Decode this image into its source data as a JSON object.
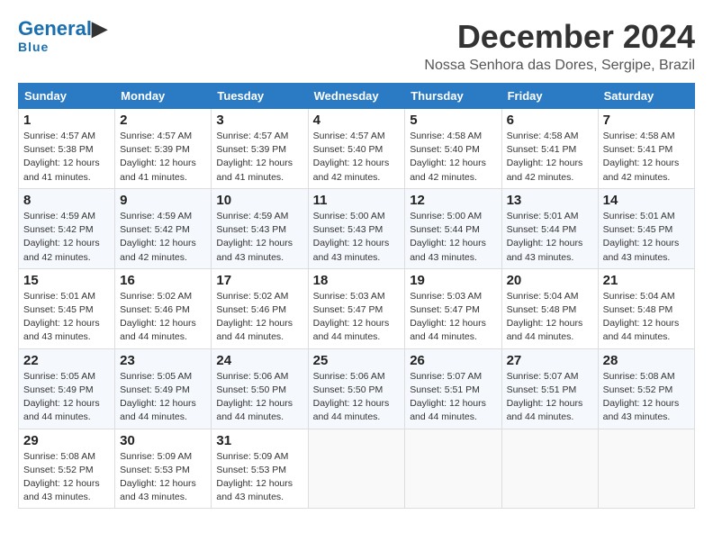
{
  "header": {
    "logo_line1": "General",
    "logo_line2": "Blue",
    "main_title": "December 2024",
    "sub_title": "Nossa Senhora das Dores, Sergipe, Brazil"
  },
  "calendar": {
    "days_of_week": [
      "Sunday",
      "Monday",
      "Tuesday",
      "Wednesday",
      "Thursday",
      "Friday",
      "Saturday"
    ],
    "weeks": [
      [
        {
          "day": "1",
          "info": "Sunrise: 4:57 AM\nSunset: 5:38 PM\nDaylight: 12 hours and 41 minutes."
        },
        {
          "day": "2",
          "info": "Sunrise: 4:57 AM\nSunset: 5:39 PM\nDaylight: 12 hours and 41 minutes."
        },
        {
          "day": "3",
          "info": "Sunrise: 4:57 AM\nSunset: 5:39 PM\nDaylight: 12 hours and 41 minutes."
        },
        {
          "day": "4",
          "info": "Sunrise: 4:57 AM\nSunset: 5:40 PM\nDaylight: 12 hours and 42 minutes."
        },
        {
          "day": "5",
          "info": "Sunrise: 4:58 AM\nSunset: 5:40 PM\nDaylight: 12 hours and 42 minutes."
        },
        {
          "day": "6",
          "info": "Sunrise: 4:58 AM\nSunset: 5:41 PM\nDaylight: 12 hours and 42 minutes."
        },
        {
          "day": "7",
          "info": "Sunrise: 4:58 AM\nSunset: 5:41 PM\nDaylight: 12 hours and 42 minutes."
        }
      ],
      [
        {
          "day": "8",
          "info": "Sunrise: 4:59 AM\nSunset: 5:42 PM\nDaylight: 12 hours and 42 minutes."
        },
        {
          "day": "9",
          "info": "Sunrise: 4:59 AM\nSunset: 5:42 PM\nDaylight: 12 hours and 42 minutes."
        },
        {
          "day": "10",
          "info": "Sunrise: 4:59 AM\nSunset: 5:43 PM\nDaylight: 12 hours and 43 minutes."
        },
        {
          "day": "11",
          "info": "Sunrise: 5:00 AM\nSunset: 5:43 PM\nDaylight: 12 hours and 43 minutes."
        },
        {
          "day": "12",
          "info": "Sunrise: 5:00 AM\nSunset: 5:44 PM\nDaylight: 12 hours and 43 minutes."
        },
        {
          "day": "13",
          "info": "Sunrise: 5:01 AM\nSunset: 5:44 PM\nDaylight: 12 hours and 43 minutes."
        },
        {
          "day": "14",
          "info": "Sunrise: 5:01 AM\nSunset: 5:45 PM\nDaylight: 12 hours and 43 minutes."
        }
      ],
      [
        {
          "day": "15",
          "info": "Sunrise: 5:01 AM\nSunset: 5:45 PM\nDaylight: 12 hours and 43 minutes."
        },
        {
          "day": "16",
          "info": "Sunrise: 5:02 AM\nSunset: 5:46 PM\nDaylight: 12 hours and 44 minutes."
        },
        {
          "day": "17",
          "info": "Sunrise: 5:02 AM\nSunset: 5:46 PM\nDaylight: 12 hours and 44 minutes."
        },
        {
          "day": "18",
          "info": "Sunrise: 5:03 AM\nSunset: 5:47 PM\nDaylight: 12 hours and 44 minutes."
        },
        {
          "day": "19",
          "info": "Sunrise: 5:03 AM\nSunset: 5:47 PM\nDaylight: 12 hours and 44 minutes."
        },
        {
          "day": "20",
          "info": "Sunrise: 5:04 AM\nSunset: 5:48 PM\nDaylight: 12 hours and 44 minutes."
        },
        {
          "day": "21",
          "info": "Sunrise: 5:04 AM\nSunset: 5:48 PM\nDaylight: 12 hours and 44 minutes."
        }
      ],
      [
        {
          "day": "22",
          "info": "Sunrise: 5:05 AM\nSunset: 5:49 PM\nDaylight: 12 hours and 44 minutes."
        },
        {
          "day": "23",
          "info": "Sunrise: 5:05 AM\nSunset: 5:49 PM\nDaylight: 12 hours and 44 minutes."
        },
        {
          "day": "24",
          "info": "Sunrise: 5:06 AM\nSunset: 5:50 PM\nDaylight: 12 hours and 44 minutes."
        },
        {
          "day": "25",
          "info": "Sunrise: 5:06 AM\nSunset: 5:50 PM\nDaylight: 12 hours and 44 minutes."
        },
        {
          "day": "26",
          "info": "Sunrise: 5:07 AM\nSunset: 5:51 PM\nDaylight: 12 hours and 44 minutes."
        },
        {
          "day": "27",
          "info": "Sunrise: 5:07 AM\nSunset: 5:51 PM\nDaylight: 12 hours and 44 minutes."
        },
        {
          "day": "28",
          "info": "Sunrise: 5:08 AM\nSunset: 5:52 PM\nDaylight: 12 hours and 43 minutes."
        }
      ],
      [
        {
          "day": "29",
          "info": "Sunrise: 5:08 AM\nSunset: 5:52 PM\nDaylight: 12 hours and 43 minutes."
        },
        {
          "day": "30",
          "info": "Sunrise: 5:09 AM\nSunset: 5:53 PM\nDaylight: 12 hours and 43 minutes."
        },
        {
          "day": "31",
          "info": "Sunrise: 5:09 AM\nSunset: 5:53 PM\nDaylight: 12 hours and 43 minutes."
        },
        null,
        null,
        null,
        null
      ]
    ]
  }
}
